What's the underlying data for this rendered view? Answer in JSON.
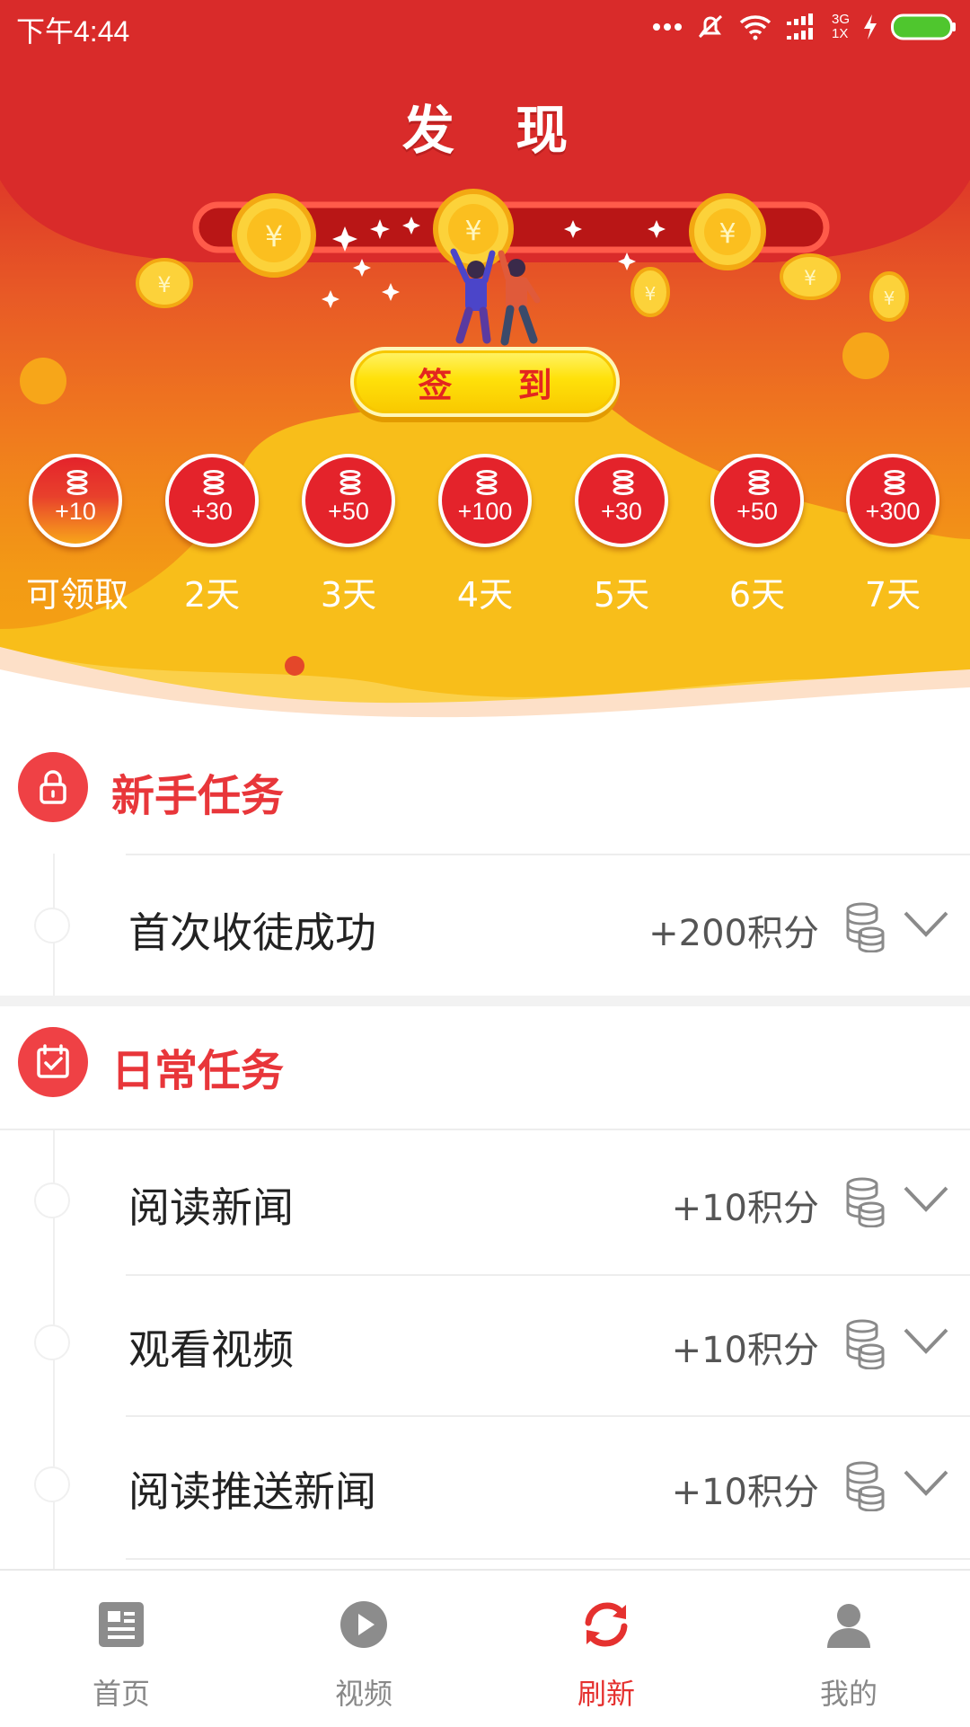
{
  "status_bar": {
    "time": "下午4:44",
    "network_top": "3G",
    "network_bottom": "1X",
    "icons": [
      "more-dots-icon",
      "mute-icon",
      "wifi-icon",
      "signal-icon",
      "charging-icon",
      "battery-icon"
    ]
  },
  "header": {
    "title": "发 现"
  },
  "checkin": {
    "button_label": "签 到",
    "days": [
      {
        "value": "+10",
        "label": "可领取",
        "claimable": true
      },
      {
        "value": "+30",
        "label": "2天"
      },
      {
        "value": "+50",
        "label": "3天"
      },
      {
        "value": "+100",
        "label": "4天"
      },
      {
        "value": "+30",
        "label": "5天"
      },
      {
        "value": "+50",
        "label": "6天"
      },
      {
        "value": "+300",
        "label": "7天"
      }
    ]
  },
  "newbie_tasks": {
    "title": "新手任务",
    "icon": "lock-icon",
    "items": [
      {
        "name": "首次收徒成功",
        "points": "+200积分"
      }
    ]
  },
  "daily_tasks": {
    "title": "日常任务",
    "icon": "calendar-check-icon",
    "items": [
      {
        "name": "阅读新闻",
        "points": "+10积分"
      },
      {
        "name": "观看视频",
        "points": "+10积分"
      },
      {
        "name": "阅读推送新闻",
        "points": "+10积分"
      }
    ]
  },
  "bottom_nav": {
    "items": [
      {
        "label": "首页",
        "icon": "news-icon"
      },
      {
        "label": "视频",
        "icon": "play-icon"
      },
      {
        "label": "刷新",
        "icon": "refresh-icon",
        "active": true
      },
      {
        "label": "我的",
        "icon": "user-icon"
      }
    ]
  },
  "colors": {
    "primary_red": "#e5312f",
    "title_red": "#e8363a",
    "accent_yellow": "#ffe10a",
    "nav_inactive": "#888888"
  }
}
